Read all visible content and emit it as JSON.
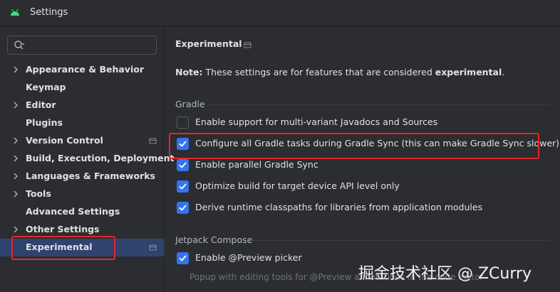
{
  "window": {
    "title": "Settings"
  },
  "search": {
    "value": "",
    "placeholder": ""
  },
  "sidebar": {
    "items": [
      {
        "label": "Appearance & Behavior",
        "expandable": true
      },
      {
        "label": "Keymap",
        "expandable": false
      },
      {
        "label": "Editor",
        "expandable": true
      },
      {
        "label": "Plugins",
        "expandable": false
      },
      {
        "label": "Version Control",
        "expandable": true,
        "project_icon": true
      },
      {
        "label": "Build, Execution, Deployment",
        "expandable": true
      },
      {
        "label": "Languages & Frameworks",
        "expandable": true
      },
      {
        "label": "Tools",
        "expandable": true
      },
      {
        "label": "Advanced Settings",
        "expandable": false
      },
      {
        "label": "Other Settings",
        "expandable": true
      },
      {
        "label": "Experimental",
        "expandable": false,
        "selected": true,
        "project_icon": true
      }
    ]
  },
  "main": {
    "title": "Experimental",
    "note": {
      "prefix": "Note:",
      "text": " These settings are for features that are considered ",
      "emphasis": "experimental",
      "suffix": "."
    },
    "gradle": {
      "label": "Gradle",
      "options": [
        {
          "label": "Enable support for multi-variant Javadocs and Sources",
          "checked": false
        },
        {
          "label": "Configure all Gradle tasks during Gradle Sync (this can make Gradle Sync slower)",
          "checked": true
        },
        {
          "label": "Enable parallel Gradle Sync",
          "checked": true
        },
        {
          "label": "Optimize build for target device API level only",
          "checked": true
        },
        {
          "label": "Derive runtime classpaths for libraries from application modules",
          "checked": true
        }
      ]
    },
    "compose": {
      "label": "Jetpack Compose",
      "options": [
        {
          "label": "Enable @Preview picker",
          "checked": true
        }
      ],
      "hint": "Popup with editing tools for @Preview annotations in the code editor"
    }
  },
  "watermark": "掘金技术社区 @ ZCurry",
  "colors": {
    "background": "#2b2d30",
    "selection": "#2e436e",
    "checkbox_on": "#3574f0",
    "highlight": "#e5262b",
    "android_green": "#3ddc84"
  }
}
